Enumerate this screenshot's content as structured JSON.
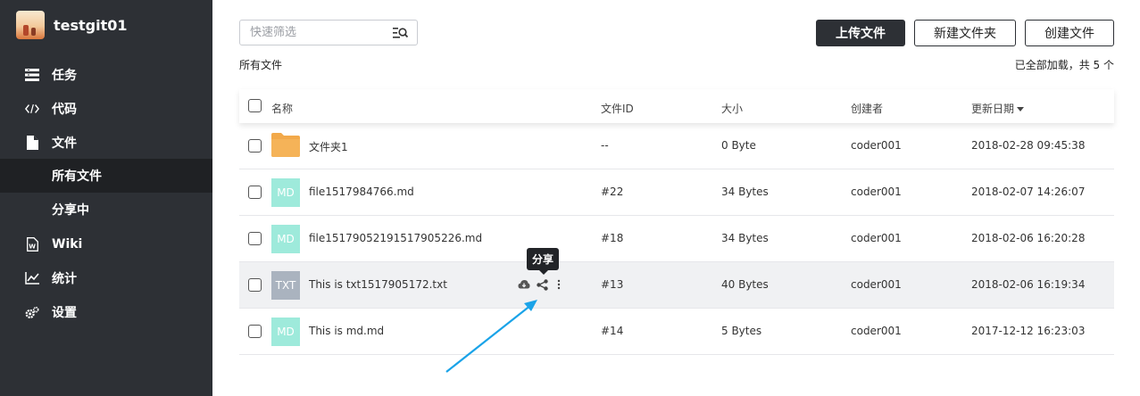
{
  "sidebar": {
    "project_name": "testgit01",
    "items": [
      {
        "label": "任务",
        "icon": "tasks-icon"
      },
      {
        "label": "代码",
        "icon": "code-icon"
      },
      {
        "label": "文件",
        "icon": "file-icon"
      },
      {
        "label": "所有文件",
        "icon": ""
      },
      {
        "label": "分享中",
        "icon": ""
      },
      {
        "label": "Wiki",
        "icon": "wiki-icon"
      },
      {
        "label": "统计",
        "icon": "chart-icon"
      },
      {
        "label": "设置",
        "icon": "settings-icon"
      }
    ],
    "active_item": "所有文件"
  },
  "toolbar": {
    "search_placeholder": "快速筛选",
    "upload_label": "上传文件",
    "new_folder_label": "新建文件夹",
    "create_file_label": "创建文件"
  },
  "breadcrumb": "所有文件",
  "load_status": "已全部加载，共 5 个",
  "table": {
    "columns": {
      "name": "名称",
      "file_id": "文件ID",
      "size": "大小",
      "creator": "创建者",
      "updated": "更新日期"
    },
    "rows": [
      {
        "type": "folder",
        "badge": "",
        "name": "文件夹1",
        "file_id": "--",
        "size": "0 Byte",
        "creator": "coder001",
        "updated": "2018-02-28 09:45:38"
      },
      {
        "type": "md",
        "badge": "MD",
        "name": "file1517984766.md",
        "file_id": "#22",
        "size": "34 Bytes",
        "creator": "coder001",
        "updated": "2018-02-07 14:26:07"
      },
      {
        "type": "md",
        "badge": "MD",
        "name": "file15179052191517905226.md",
        "file_id": "#18",
        "size": "34 Bytes",
        "creator": "coder001",
        "updated": "2018-02-06 16:20:28"
      },
      {
        "type": "txt",
        "badge": "TXT",
        "name": "This is txt1517905172.txt",
        "file_id": "#13",
        "size": "40 Bytes",
        "creator": "coder001",
        "updated": "2018-02-06 16:19:34"
      },
      {
        "type": "md",
        "badge": "MD",
        "name": "This is md.md",
        "file_id": "#14",
        "size": "5 Bytes",
        "creator": "coder001",
        "updated": "2017-12-12 16:23:03"
      }
    ]
  },
  "tooltip": "分享",
  "colors": {
    "sidebar_bg": "#2d3035",
    "sidebar_active": "#1f2124",
    "md_badge": "#9eeadb",
    "txt_badge": "#aab3bf",
    "folder": "#f2a94a",
    "annotation_arrow": "#1aa3e8"
  }
}
